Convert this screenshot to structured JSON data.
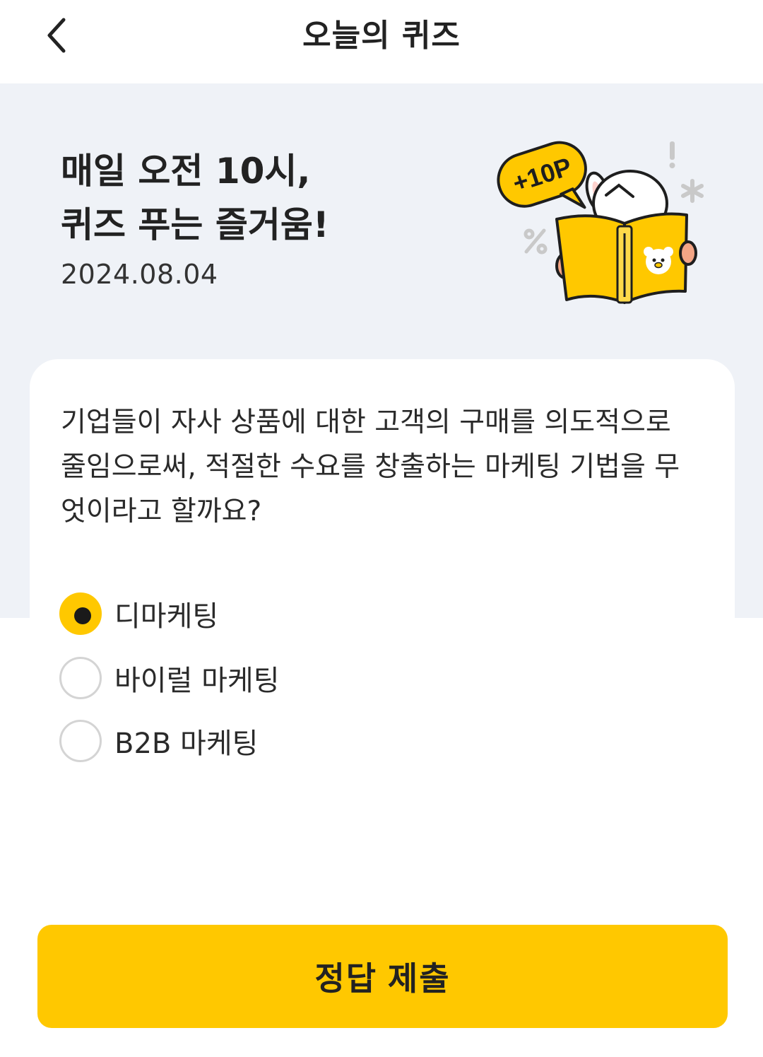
{
  "header": {
    "title": "오늘의 퀴즈",
    "back_icon": "chevron-left-icon"
  },
  "hero": {
    "title_line1": "매일 오전 10시,",
    "title_line2": "퀴즈 푸는 즐거움!",
    "date": "2024.08.04",
    "badge": "+10P"
  },
  "quiz": {
    "question": "기업들이 자사 상품에 대한 고객의 구매를 의도적으로 줄임으로써, 적절한 수요를 창출하는 마케팅 기법을 무엇이라고 할까요?",
    "options": [
      {
        "label": "디마케팅",
        "selected": true
      },
      {
        "label": "바이럴 마케팅",
        "selected": false
      },
      {
        "label": "B2B 마케팅",
        "selected": false
      }
    ]
  },
  "submit": {
    "label": "정답 제출"
  },
  "colors": {
    "accent": "#ffc800",
    "hero_background": "#eff2f7",
    "text": "#222222"
  }
}
